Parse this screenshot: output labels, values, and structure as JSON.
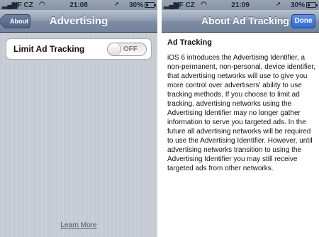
{
  "left": {
    "statusbar": {
      "carrier": "VF CZ",
      "time": "21:08",
      "battery": "30%",
      "battery_level": 0.3
    },
    "navbar": {
      "back_label": "About",
      "title": "Advertising"
    },
    "setting": {
      "label": "Limit Ad Tracking",
      "toggle_state": "OFF"
    },
    "footer_link": "Learn More"
  },
  "right": {
    "statusbar": {
      "carrier": "VF CZ",
      "time": "21:09",
      "battery": "30%",
      "battery_level": 0.3
    },
    "navbar": {
      "title": "About Ad Tracking",
      "done_label": "Done"
    },
    "heading": "Ad Tracking",
    "body": "iOS 6 introduces the Advertising Identifier, a non-permanent, non-personal, device identifier, that advertising networks will use to give you more control over advertisers' ability to use tracking methods. If you choose to limit ad tracking, advertising networks using the Advertising Identifier may no longer gather information to serve you targeted ads. In the future all advertising networks will be required to use the Advertising Identifier. However, until advertising networks transition to using the Advertising Identifier you may still receive targeted ads from other networks."
  },
  "icons": {
    "signal": "signal-bars-icon",
    "wifi": "wifi-icon",
    "lock": "orientation-lock-icon",
    "battery": "battery-icon"
  }
}
